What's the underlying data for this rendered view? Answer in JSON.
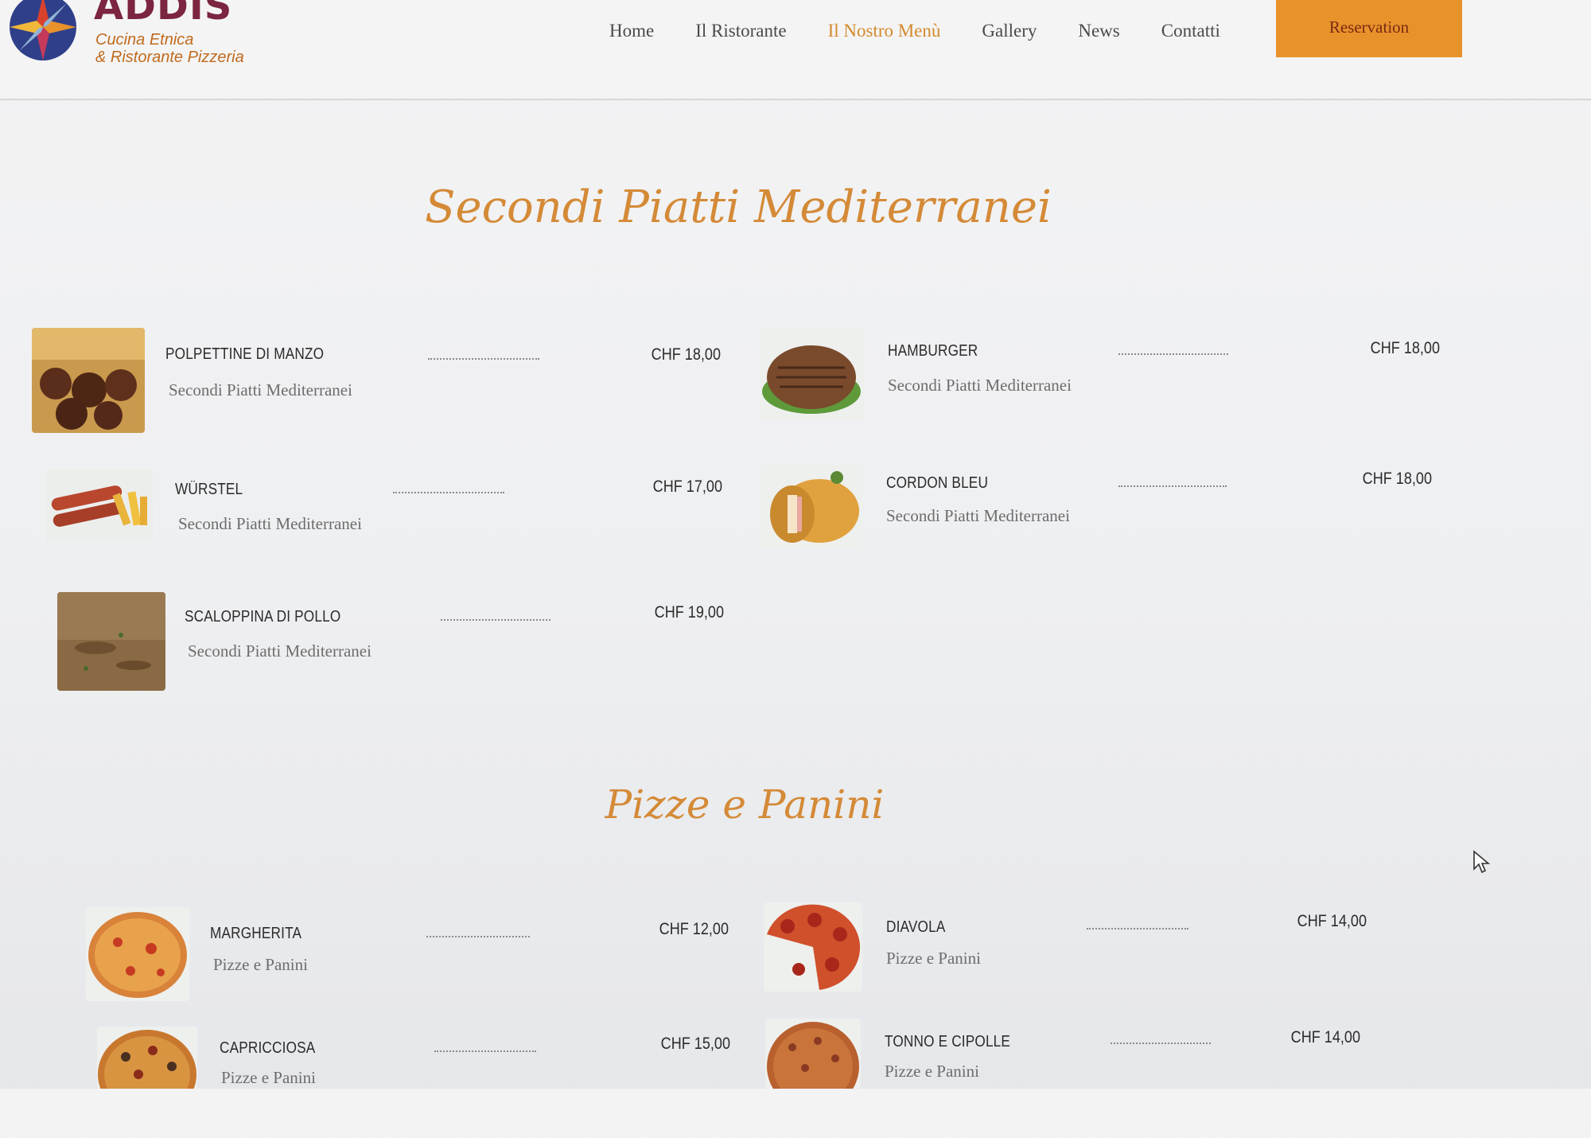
{
  "header": {
    "logo": {
      "name": "ADDIS",
      "line1": "Cucina Etnica",
      "line2": "& Ristorante Pizzeria"
    },
    "nav": [
      {
        "label": "Home",
        "active": false
      },
      {
        "label": "Il Ristorante",
        "active": false
      },
      {
        "label": "Il Nostro Menù",
        "active": true
      },
      {
        "label": "Gallery",
        "active": false
      },
      {
        "label": "News",
        "active": false
      },
      {
        "label": "Contatti",
        "active": false
      }
    ],
    "reservation_label": "Reservation"
  },
  "sections": [
    {
      "title": "Secondi Piatti Mediterranei",
      "items": [
        {
          "name": "POLPETTINE DI MANZO",
          "category": "Secondi Piatti Mediterranei",
          "price": "CHF 18,00",
          "image": "meatballs"
        },
        {
          "name": "HAMBURGER",
          "category": "Secondi Piatti Mediterranei",
          "price": "CHF 18,00",
          "image": "burger-patty"
        },
        {
          "name": "WÜRSTEL",
          "category": "Secondi Piatti Mediterranei",
          "price": "CHF 17,00",
          "image": "sausages"
        },
        {
          "name": "CORDON BLEU",
          "category": "Secondi Piatti Mediterranei",
          "price": "CHF 18,00",
          "image": "cordon-bleu"
        },
        {
          "name": "SCALOPPINA DI POLLO",
          "category": "Secondi Piatti Mediterranei",
          "price": "CHF 19,00",
          "image": "chicken-scaloppina"
        }
      ]
    },
    {
      "title": "Pizze e Panini",
      "items": [
        {
          "name": "MARGHERITA",
          "category": "Pizze e Panini",
          "price": "CHF 12,00",
          "image": "pizza-margherita"
        },
        {
          "name": "DIAVOLA",
          "category": "Pizze e Panini",
          "price": "CHF 14,00",
          "image": "pizza-diavola"
        },
        {
          "name": "CAPRICCIOSA",
          "category": "Pizze e Panini",
          "price": "CHF 15,00",
          "image": "pizza-capricciosa"
        },
        {
          "name": "TONNO E CIPOLLE",
          "category": "Pizze e Panini",
          "price": "CHF 14,00",
          "image": "pizza-tonno"
        }
      ]
    }
  ],
  "colors": {
    "accent": "#e8922b",
    "title": "#d48a37",
    "logo": "#7b2540"
  }
}
